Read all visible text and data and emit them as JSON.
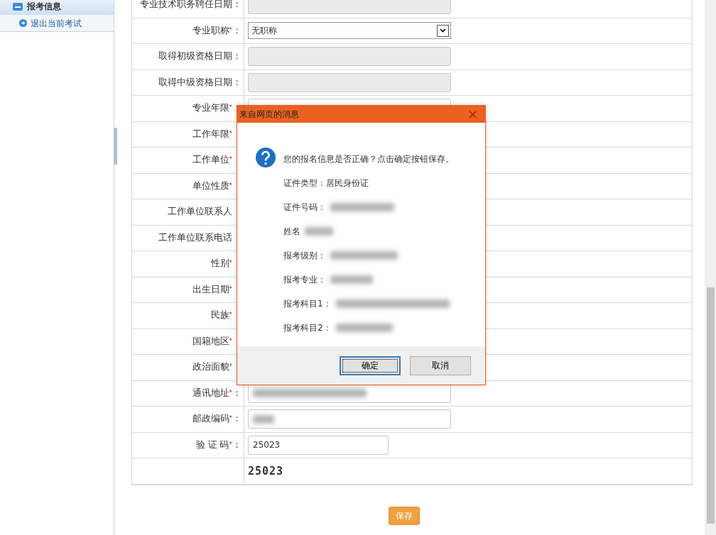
{
  "sidebar": {
    "header": "报考信息",
    "items": [
      {
        "label": "退出当前考试"
      }
    ]
  },
  "form": {
    "rows": [
      {
        "label": "专业技术职务聘任日期",
        "colon": "：",
        "kind": "input",
        "disabled": true
      },
      {
        "label": "专业职称",
        "mark": "*",
        "colon": "：",
        "kind": "select",
        "value": "无职称"
      },
      {
        "label": "取得初级资格日期",
        "colon": "：",
        "kind": "input",
        "disabled": true
      },
      {
        "label": "取得中级资格日期",
        "colon": "：",
        "kind": "input",
        "disabled": true
      },
      {
        "label": "专业年限",
        "mark": "*",
        "kind": "input"
      },
      {
        "label": "工作年限",
        "mark": "*"
      },
      {
        "label": "工作单位",
        "mark": "*"
      },
      {
        "label": "单位性质",
        "mark": "*"
      },
      {
        "label": "工作单位联系人"
      },
      {
        "label": "工作单位联系电话"
      },
      {
        "label": "性别",
        "mark": "*"
      },
      {
        "label": "出生日期",
        "mark": "*"
      },
      {
        "label": "民族",
        "mark": "*"
      },
      {
        "label": "国籍地区",
        "mark": "*"
      },
      {
        "label": "政治面貌",
        "mark": "*"
      },
      {
        "label": "通讯地址",
        "mark": "*",
        "colon": "：",
        "kind": "input",
        "redacted": true
      },
      {
        "label": "邮政编码",
        "mark": "*",
        "colon": "：",
        "kind": "input",
        "redacted": true
      },
      {
        "label": "验 证 码",
        "mark": "*",
        "colon": "：",
        "kind": "input",
        "value": "25023",
        "short": true
      },
      {
        "kind": "captcha",
        "value": "25023"
      }
    ],
    "save_button": "保存"
  },
  "dialog": {
    "title": "来自网页的消息",
    "close": "×",
    "message": "您的报名信息是否正确？点击确定按钮保存。",
    "lines": [
      {
        "label": "证件类型：居民身份证"
      },
      {
        "label": "证件号码：",
        "redacted": true
      },
      {
        "label": "姓名",
        "redacted": true
      },
      {
        "label": "报考级别：",
        "redacted": true
      },
      {
        "label": "报考专业：",
        "redacted": true
      },
      {
        "label": "报考科目1：",
        "redacted": true
      },
      {
        "label": "报考科目2：",
        "redacted": true
      }
    ],
    "buttons": [
      {
        "label": "确定",
        "focused": true
      },
      {
        "label": "取消",
        "focused": false
      }
    ]
  }
}
